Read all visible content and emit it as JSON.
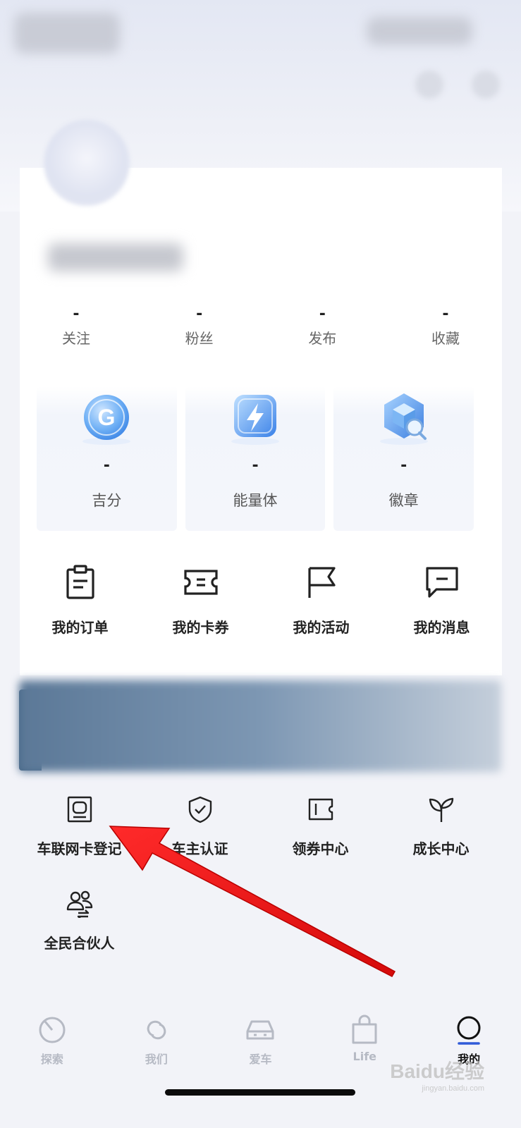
{
  "stats": [
    {
      "value": "-",
      "label": "关注"
    },
    {
      "value": "-",
      "label": "粉丝"
    },
    {
      "value": "-",
      "label": "发布"
    },
    {
      "value": "-",
      "label": "收藏"
    }
  ],
  "tiles": [
    {
      "value": "-",
      "label": "吉分",
      "badge_text": "G",
      "icon": "coin-icon"
    },
    {
      "value": "-",
      "label": "能量体",
      "icon": "lightning-icon"
    },
    {
      "value": "-",
      "label": "徽章",
      "icon": "badge-cube-icon"
    }
  ],
  "quick_actions": [
    {
      "label": "我的订单",
      "icon": "clipboard-icon"
    },
    {
      "label": "我的卡券",
      "icon": "ticket-icon"
    },
    {
      "label": "我的活动",
      "icon": "flag-icon"
    },
    {
      "label": "我的消息",
      "icon": "message-icon"
    }
  ],
  "services": [
    {
      "label": "车联网卡登记",
      "icon": "id-card-icon"
    },
    {
      "label": "车主认证",
      "icon": "shield-check-icon"
    },
    {
      "label": "领券中心",
      "icon": "coupon-icon"
    },
    {
      "label": "成长中心",
      "icon": "sprout-icon"
    },
    {
      "label": "全民合伙人",
      "icon": "partners-icon"
    }
  ],
  "tabbar": [
    {
      "label": "探索",
      "icon": "explore-icon"
    },
    {
      "label": "我们",
      "icon": "link-icon"
    },
    {
      "label": "爱车",
      "icon": "car-icon"
    },
    {
      "label": "Life",
      "icon": "shopping-bag-icon"
    },
    {
      "label": "我的",
      "icon": "profile-circle-icon",
      "active": true
    }
  ],
  "watermark": {
    "main": "Baidu经验",
    "sub": "jingyan.baidu.com"
  },
  "colors": {
    "accent": "#2f5bd8",
    "text_primary": "#222222",
    "text_secondary": "#666666",
    "tab_inactive": "#b6bac4",
    "arrow": "#e8100f"
  }
}
